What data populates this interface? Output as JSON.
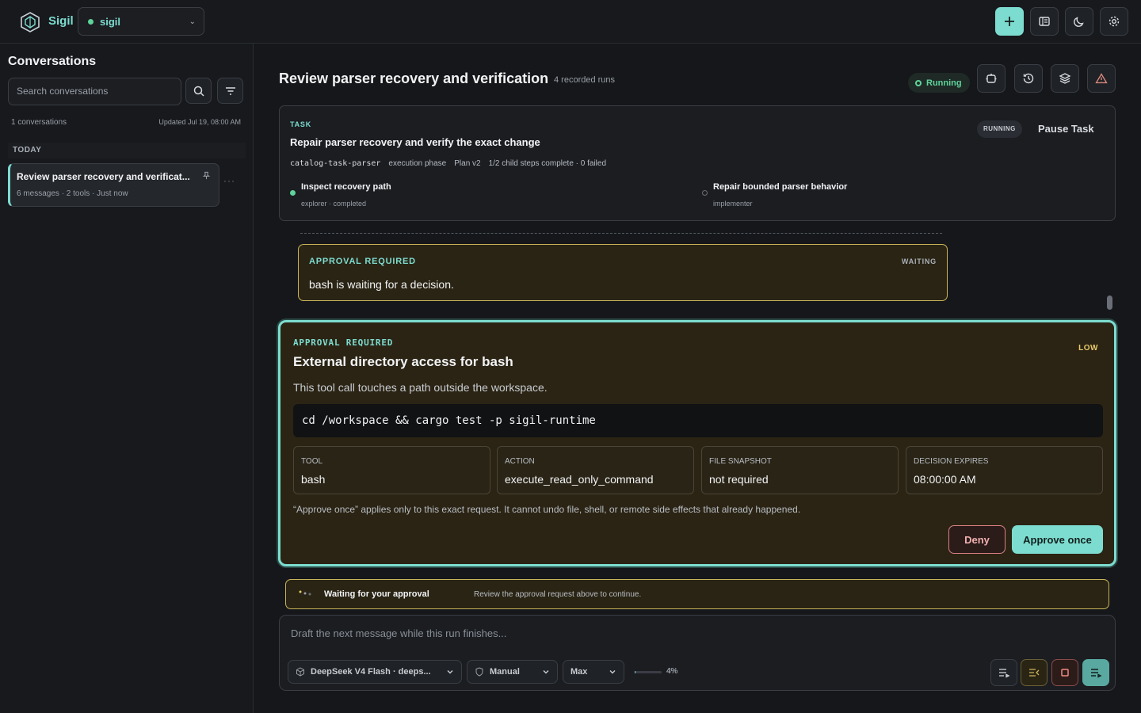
{
  "app": {
    "brand": "Sigil",
    "workspace": "sigil"
  },
  "colors": {
    "accent": "#7ddcd0",
    "warning": "#c9b45a",
    "success": "#5fd39a",
    "danger": "#d98080"
  },
  "sidebar": {
    "title": "Conversations",
    "search_placeholder": "Search conversations",
    "count": "1 conversations",
    "updated": "Updated Jul 19, 08:00 AM",
    "section": "TODAY",
    "items": [
      {
        "title": "Review parser recovery and verificat...",
        "meta": "6 messages · 2 tools · Just now"
      }
    ]
  },
  "main": {
    "title": "Review parser recovery and verification",
    "runs": "4 recorded runs",
    "status": "Running",
    "task": {
      "tag": "TASK",
      "title": "Repair parser recovery and verify the exact change",
      "id": "catalog-task-parser",
      "phase": "execution phase",
      "plan": "Plan v2",
      "progress": "1/2 child steps complete · 0 failed",
      "badge": "RUNNING",
      "pause": "Pause Task",
      "steps": [
        {
          "name": "Inspect recovery path",
          "meta": "explorer · completed",
          "status": "done"
        },
        {
          "name": "Repair bounded parser behavior",
          "meta": "implementer",
          "status": "pending"
        }
      ]
    },
    "approval_small": {
      "tag": "APPROVAL REQUIRED",
      "state": "WAITING",
      "text": "bash is waiting for a decision."
    },
    "approval": {
      "tag": "APPROVAL REQUIRED",
      "risk": "LOW",
      "title": "External directory access for bash",
      "desc": "This tool call touches a path outside the workspace.",
      "command": "cd /workspace && cargo test -p sigil-runtime",
      "facts": [
        {
          "k": "TOOL",
          "v": "bash"
        },
        {
          "k": "ACTION",
          "v": "execute_read_only_command"
        },
        {
          "k": "FILE SNAPSHOT",
          "v": "not required"
        },
        {
          "k": "DECISION EXPIRES",
          "v": "08:00:00 AM"
        }
      ],
      "note": "“Approve once” applies only to this exact request. It cannot undo file, shell, or remote side effects that already happened.",
      "deny": "Deny",
      "approve": "Approve once"
    },
    "waiting": {
      "title": "Waiting for your approval",
      "sub": "Review the approval request above to continue."
    },
    "composer": {
      "placeholder": "Draft the next message while this run finishes...",
      "model": "DeepSeek V4 Flash · deeps...",
      "mode": "Manual",
      "effort": "Max",
      "context_pct": "4%",
      "context_fraction": 0.04
    }
  }
}
